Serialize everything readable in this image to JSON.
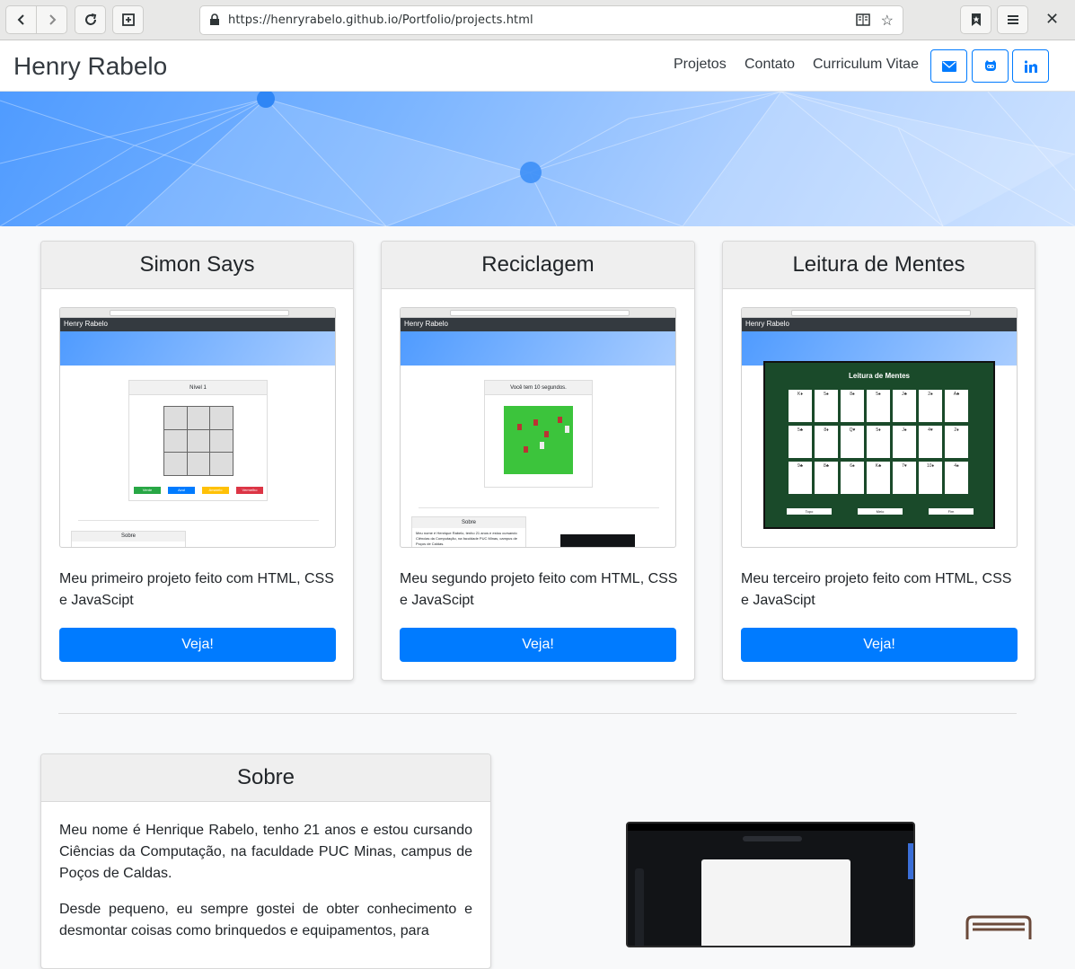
{
  "browser": {
    "url": "https://henryrabelo.github.io/Portfolio/projects.html"
  },
  "navbar": {
    "brand": "Henry Rabelo",
    "links": [
      "Projetos",
      "Contato",
      "Curriculum Vitae"
    ]
  },
  "projects": [
    {
      "title": "Simon Says",
      "description": "Meu primeiro projeto feito com HTML, CSS e JavaScipt",
      "button": "Veja!"
    },
    {
      "title": "Reciclagem",
      "description": "Meu segundo projeto feito com HTML, CSS e JavaScipt",
      "button": "Veja!"
    },
    {
      "title": "Leitura de Mentes",
      "description": "Meu terceiro projeto feito com HTML, CSS e JavaScipt",
      "button": "Veja!"
    }
  ],
  "thumbs": {
    "brand": "Henry Rabelo",
    "simon_level": "Nível 1",
    "simon_buttons": [
      "Verde",
      "Azul",
      "Amarelo",
      "Vermelho"
    ],
    "simon_about": "Sobre",
    "recicla_timer": "Você tem 10 segundos.",
    "recicla_about": "Sobre",
    "recicla_about_text": "Meu nome é Henrique Rabelo, tenho 21 anos e estou cursando Ciências da Computação, na faculdade PUC Minas, campus de Poços de Caldas.",
    "mentes_title": "Leitura de Mentes",
    "mentes_cards": [
      "K♦",
      "5♠",
      "8♠",
      "5♠",
      "J♣",
      "2♠",
      "A♣",
      "5♣",
      "8♦",
      "Q♥",
      "5♦",
      "J♠",
      "4♥",
      "2♦",
      "9♣",
      "8♣",
      "6♠",
      "K♣",
      "7♥",
      "10♦",
      "4♠"
    ],
    "mentes_buttons": [
      "Topo",
      "Meio",
      "Fim"
    ]
  },
  "sobre": {
    "title": "Sobre",
    "p1": "Meu nome é Henrique Rabelo, tenho 21 anos e estou cursando Ciências da Computação, na faculdade PUC Minas, campus de Poços de Caldas.",
    "p2": "Desde pequeno, eu sempre gostei de obter conhecimento e desmontar coisas como brinquedos e equipamentos, para"
  },
  "colors": {
    "primary": "#007bff",
    "dark": "#343a40"
  }
}
